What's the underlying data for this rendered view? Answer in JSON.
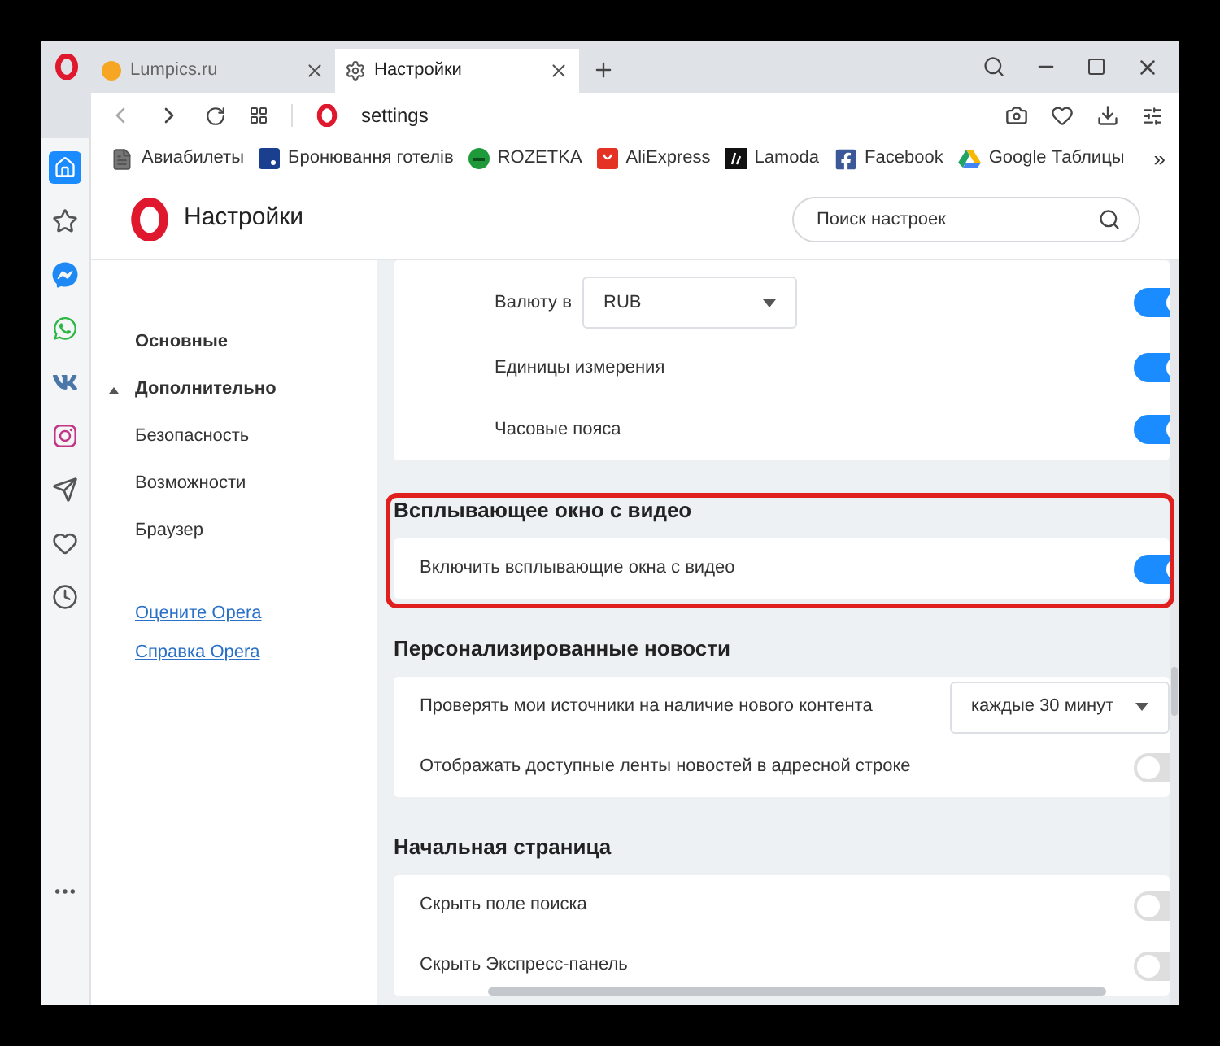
{
  "tabs": [
    {
      "title": "Lumpics.ru",
      "kind": "site",
      "selected": false
    },
    {
      "title": "Настройки",
      "kind": "settings",
      "selected": true
    }
  ],
  "address": "settings",
  "bookmarks": [
    {
      "label": "Авиабилеты",
      "kind": "doc"
    },
    {
      "label": "Бронювання готелів",
      "kind": "booking"
    },
    {
      "label": "ROZETKA",
      "kind": "rozetka"
    },
    {
      "label": "AliExpress",
      "kind": "aliexpress"
    },
    {
      "label": "Lamoda",
      "kind": "lamoda"
    },
    {
      "label": "Facebook",
      "kind": "facebook"
    },
    {
      "label": "Google Таблицы",
      "kind": "drive"
    }
  ],
  "bookmarks_more": "»",
  "sidebar": [
    {
      "kind": "home",
      "selected": true
    },
    {
      "kind": "star",
      "selected": false
    },
    {
      "kind": "messenger",
      "selected": false
    },
    {
      "kind": "whatsapp",
      "selected": false
    },
    {
      "kind": "vk",
      "selected": false
    },
    {
      "kind": "instagram",
      "selected": false
    },
    {
      "kind": "send",
      "selected": false
    },
    {
      "kind": "heart",
      "selected": false
    },
    {
      "kind": "history",
      "selected": false
    },
    {
      "kind": "more",
      "selected": false
    }
  ],
  "settings_title": "Настройки",
  "search": {
    "placeholder": "Поиск настроек"
  },
  "nav": [
    {
      "label": "Основные",
      "kind": "main"
    },
    {
      "label": "Дополнительно",
      "kind": "group",
      "expanded": true
    },
    {
      "label": "Безопасность",
      "kind": "sub"
    },
    {
      "label": "Возможности",
      "kind": "sub"
    },
    {
      "label": "Браузер",
      "kind": "sub"
    }
  ],
  "links": [
    "Оцените Opera",
    "Справка Opera"
  ],
  "sections": [
    {
      "highlighted": false,
      "rows": [
        {
          "kind": "sub-select",
          "label": "Валюту в",
          "value": "RUB",
          "on": true
        },
        {
          "kind": "sub-toggle",
          "label": "Единицы измерения",
          "on": true
        },
        {
          "kind": "sub-toggle",
          "label": "Часовые пояса",
          "on": true
        }
      ]
    },
    {
      "title": "Всплывающее окно с видео",
      "highlighted": true,
      "rows": [
        {
          "kind": "toggle",
          "label": "Включить всплывающие окна с видео",
          "on": true
        }
      ]
    },
    {
      "title": "Персонализированные новости",
      "highlighted": false,
      "rows": [
        {
          "kind": "select",
          "label": "Проверять мои источники на наличие нового контента",
          "value": "каждые 30 минут"
        },
        {
          "kind": "toggle",
          "label": "Отображать доступные ленты новостей в адресной строке",
          "on": false
        }
      ]
    },
    {
      "title": "Начальная страница",
      "highlighted": false,
      "rows": [
        {
          "kind": "toggle",
          "label": "Скрыть поле поиска",
          "on": false
        },
        {
          "kind": "toggle",
          "label": "Скрыть Экспресс-панель",
          "on": false
        }
      ]
    }
  ]
}
